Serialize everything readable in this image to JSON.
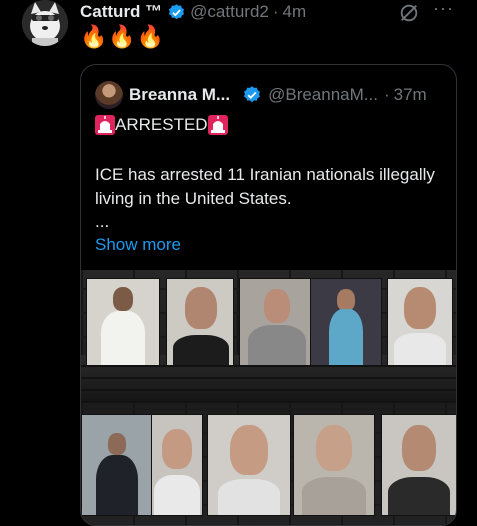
{
  "tweet": {
    "author_name": "Catturd ™",
    "handle": "@catturd2",
    "time": "4m",
    "text": "🔥🔥🔥"
  },
  "quote": {
    "author_name": "Breanna M...",
    "handle": "@BreannaM...",
    "time": "37m",
    "alert_text": "ARRESTED",
    "body": "ICE has arrested 11 Iranian nationals illegally living in the United States.",
    "ellipsis": "...",
    "show_more": "Show more"
  },
  "colors": {
    "background": "#000000",
    "link": "#1d9bf0",
    "verified": "#1d9bf0",
    "muted": "#71767b"
  },
  "icons": [
    "verified-badge-icon",
    "grok-icon",
    "more-icon",
    "siren-icon"
  ]
}
